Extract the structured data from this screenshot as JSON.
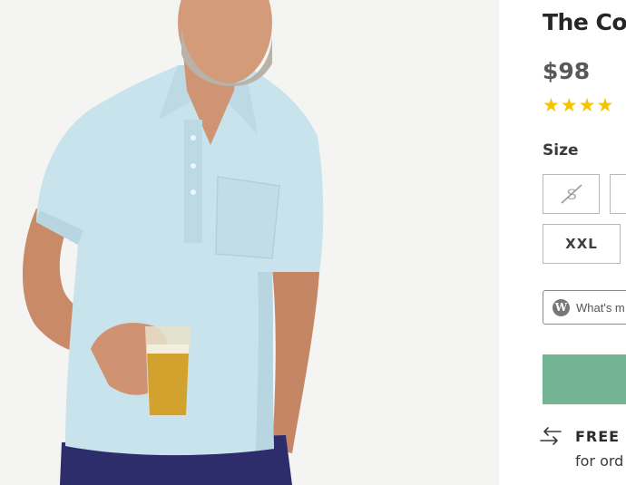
{
  "product": {
    "title": "The Co",
    "price": "$98",
    "rating_stars": 4,
    "stars_text": "★★★★",
    "image_alt": "Man wearing light blue polo shirt holding a glass of beer"
  },
  "size": {
    "label": "Size",
    "options": [
      {
        "label": "S",
        "available": false
      },
      {
        "label": "",
        "available": true
      },
      {
        "label": "XXL",
        "available": true
      }
    ]
  },
  "fit_widget": {
    "logo_letter": "W",
    "text": "What's m"
  },
  "add_to_cart": {
    "color": "#72b493"
  },
  "shipping": {
    "title": "FREE S",
    "subtitle": "for ord"
  },
  "colors": {
    "shirt": "#c9e3ec",
    "pants": "#2e2d6b",
    "star": "#f7c300",
    "button": "#72b493"
  }
}
